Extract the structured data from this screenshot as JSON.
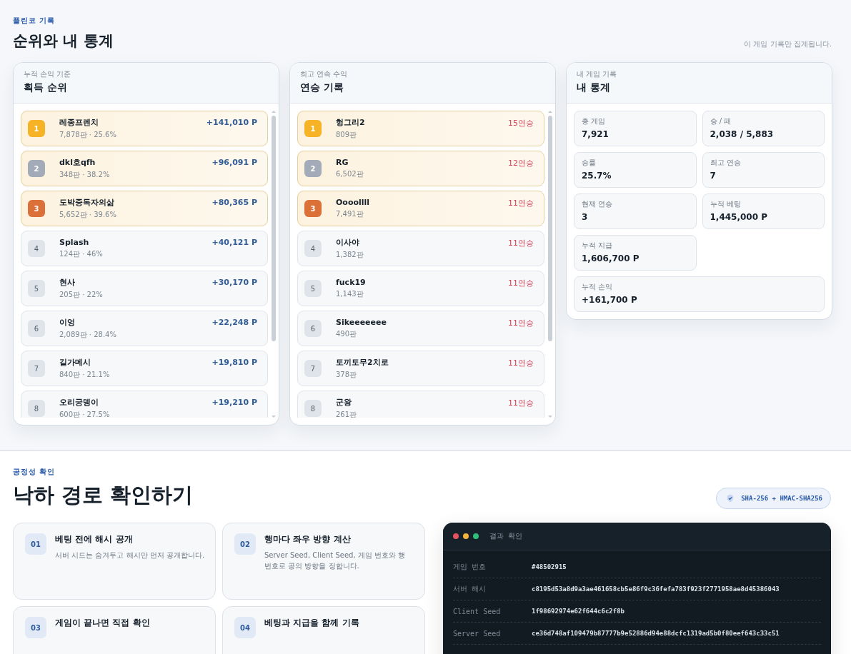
{
  "records": {
    "eyebrow": "플린코 기록",
    "title": "순위와 내 통계",
    "note": "이 게임 기록만 집계됩니다.",
    "panels": [
      {
        "kind": "ranking",
        "subtitle": "누적 손익 기준",
        "title": "획득 순위",
        "rows": [
          {
            "rank": "1",
            "highlighted": true,
            "color": "#f5b325",
            "name": "레종프렌치",
            "detail": "7,878판 · 25.6%",
            "value": "+141,010 P"
          },
          {
            "rank": "2",
            "highlighted": true,
            "color": "#a3abb8",
            "name": "dkl호qfh",
            "detail": "348판 · 38.2%",
            "value": "+96,091 P"
          },
          {
            "rank": "3",
            "highlighted": true,
            "color": "#db7038",
            "name": "도박중독자의삶",
            "detail": "5,652판 · 39.6%",
            "value": "+80,365 P"
          },
          {
            "rank": "4",
            "highlighted": false,
            "color": "#dfe4ea",
            "name": "Splash",
            "detail": "124판 · 46%",
            "value": "+40,121 P"
          },
          {
            "rank": "5",
            "highlighted": false,
            "color": "#dfe4ea",
            "name": "현사",
            "detail": "205판 · 22%",
            "value": "+30,170 P"
          },
          {
            "rank": "6",
            "highlighted": false,
            "color": "#dfe4ea",
            "name": "이엉",
            "detail": "2,089판 · 28.4%",
            "value": "+22,248 P"
          },
          {
            "rank": "7",
            "highlighted": false,
            "color": "#dfe4ea",
            "name": "길가메시",
            "detail": "840판 · 21.1%",
            "value": "+19,810 P"
          },
          {
            "rank": "8",
            "highlighted": false,
            "color": "#dfe4ea",
            "name": "오리궁뎅이",
            "detail": "600판 · 27.5%",
            "value": "+19,210 P"
          }
        ]
      },
      {
        "kind": "streak",
        "subtitle": "최고 연속 수익",
        "title": "연승 기록",
        "rows": [
          {
            "rank": "1",
            "highlighted": true,
            "color": "#f5b325",
            "name": "헝그리2",
            "detail": "809판",
            "value": "15연승"
          },
          {
            "rank": "2",
            "highlighted": true,
            "color": "#a3abb8",
            "name": "RG",
            "detail": "6,502판",
            "value": "12연승"
          },
          {
            "rank": "3",
            "highlighted": true,
            "color": "#db7038",
            "name": "Oooollll",
            "detail": "7,491판",
            "value": "11연승"
          },
          {
            "rank": "4",
            "highlighted": false,
            "color": "#dfe4ea",
            "name": "이사야",
            "detail": "1,382판",
            "value": "11연승"
          },
          {
            "rank": "5",
            "highlighted": false,
            "color": "#dfe4ea",
            "name": "fuck19",
            "detail": "1,143판",
            "value": "11연승"
          },
          {
            "rank": "6",
            "highlighted": false,
            "color": "#dfe4ea",
            "name": "Sikeeeeeee",
            "detail": "490판",
            "value": "11연승"
          },
          {
            "rank": "7",
            "highlighted": false,
            "color": "#dfe4ea",
            "name": "토끼토무2치로",
            "detail": "378판",
            "value": "11연승"
          },
          {
            "rank": "8",
            "highlighted": false,
            "color": "#dfe4ea",
            "name": "군왕",
            "detail": "261판",
            "value": "11연승"
          }
        ]
      }
    ],
    "stats": {
      "subtitle": "내 게임 기록",
      "title": "내 통계",
      "items": [
        {
          "label": "총 게임",
          "value": "7,921",
          "wide": false
        },
        {
          "label": "승 / 패",
          "value": "2,038 / 5,883",
          "wide": false
        },
        {
          "label": "승률",
          "value": "25.7%",
          "wide": false
        },
        {
          "label": "최고 연승",
          "value": "7",
          "wide": false
        },
        {
          "label": "현재 연승",
          "value": "3",
          "wide": false
        },
        {
          "label": "누적 베팅",
          "value": "1,445,000 P",
          "wide": false
        },
        {
          "label": "누적 지급",
          "value": "1,606,700 P",
          "wide": false
        },
        {
          "label": "누적 손익",
          "value": "+161,700 P",
          "wide": true
        }
      ]
    }
  },
  "fairness": {
    "eyebrow": "공정성 확인",
    "title": "낙하 경로 확인하기",
    "badge": "SHA-256 + HMAC-SHA256",
    "steps": [
      {
        "number": "01",
        "title": "베팅 전에 해시 공개",
        "text": "서버 시드는 숨겨두고 해시만 먼저 공개합니다."
      },
      {
        "number": "02",
        "title": "행마다 좌우 방향 계산",
        "text": "Server Seed, Client Seed, 게임 번호와 행 번호로 공의 방향을 정합니다."
      },
      {
        "number": "03",
        "title": "게임이 끝나면 직접 확인"
      },
      {
        "number": "04",
        "title": "베팅과 지급을 함께 기록"
      }
    ],
    "terminal": {
      "title": "결과 확인",
      "rows": [
        {
          "label": "게임 번호",
          "value": "#48502915"
        },
        {
          "label": "서버 해시",
          "value": "c8195d53a8d9a3ae461658cb5e86f9c36fefa783f923f2771958ae8d45386043"
        },
        {
          "label": "Client Seed",
          "value": "1f98692974e62f644c6c2f8b"
        },
        {
          "label": "Server Seed",
          "value": "ce36d748af109479b87777b9e52886d94e88dcfc1319ad5b0f80eef643c33c51"
        }
      ]
    }
  }
}
